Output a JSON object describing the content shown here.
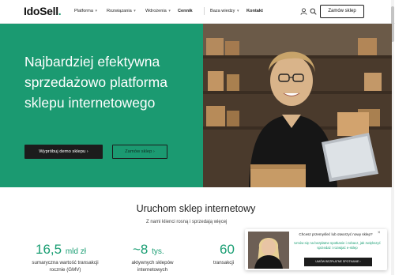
{
  "header": {
    "logo_text": "IdoSell",
    "logo_dot": ".",
    "nav": [
      {
        "label": "Platforma",
        "chevron": "▾"
      },
      {
        "label": "Rozwiązania",
        "chevron": "▾"
      },
      {
        "label": "Wdrożenia",
        "chevron": "▾"
      },
      {
        "label": "Cennik"
      },
      {
        "label": "Baza wiedzy",
        "chevron": "▾"
      },
      {
        "label": "Kontakt"
      }
    ],
    "icons": [
      "user-icon",
      "search-icon"
    ],
    "order_button": "Zamów sklep"
  },
  "hero": {
    "title": "Najbardziej efektywna sprzedażowo platforma sklepu internetowego",
    "demo_button": "Wypróbuj demo sklepu ›",
    "order_button": "Zamów sklep ›"
  },
  "section": {
    "title": "Uruchom sklep internetowy",
    "subtitle": "Z nami klienci rosną i sprzedają więcej"
  },
  "stats": [
    {
      "value": "16,5",
      "unit": "mld zł",
      "label": "sumaryczna wartość transakcji rocznie (GMV)"
    },
    {
      "value": "~8",
      "unit": "tys.",
      "label": "aktywnych sklepów internetowych"
    },
    {
      "value": "60",
      "unit": "",
      "label": "transakcji"
    }
  ],
  "chat": {
    "title": "Chcesz przemyśleć lub otworzyć nowy sklep?",
    "body": "Umów się na bezpłatne spotkanie i zobacz, jak zwiększyć sprzedaż i rozwijać e-sklep",
    "button": "UMÓW BEZPŁATNE SPOTKANIE ›",
    "close": "×"
  },
  "colors": {
    "accent": "#1b9a71",
    "dark": "#1c1c1c"
  }
}
